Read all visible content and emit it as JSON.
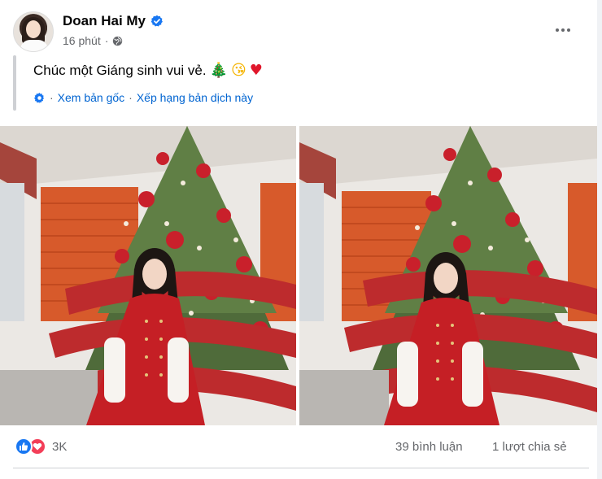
{
  "post": {
    "author": "Doan Hai My",
    "time": "16 phút",
    "text": "Chúc một Giáng sinh vui vẻ.",
    "emojis": [
      "🎄",
      "😘",
      "♥"
    ],
    "translation": {
      "view_original": "Xem bản gốc",
      "separator": "·",
      "rate_translation": "Xếp hạng bản dịch này"
    },
    "photos_count": 2
  },
  "footer": {
    "reaction_count": "3K",
    "comments": "39 bình luận",
    "shares": "1 lượt chia sẻ"
  },
  "colors": {
    "link": "#0064d1",
    "secondary_text": "#65676b",
    "like_blue": "#1877f2",
    "love_red": "#f33e58",
    "verified_blue": "#1877f2"
  },
  "icons": {
    "verified": "verified-badge-icon",
    "privacy": "globe-icon",
    "more": "more-options-icon",
    "translate": "gear-icon",
    "like": "like-icon",
    "love": "love-icon"
  }
}
